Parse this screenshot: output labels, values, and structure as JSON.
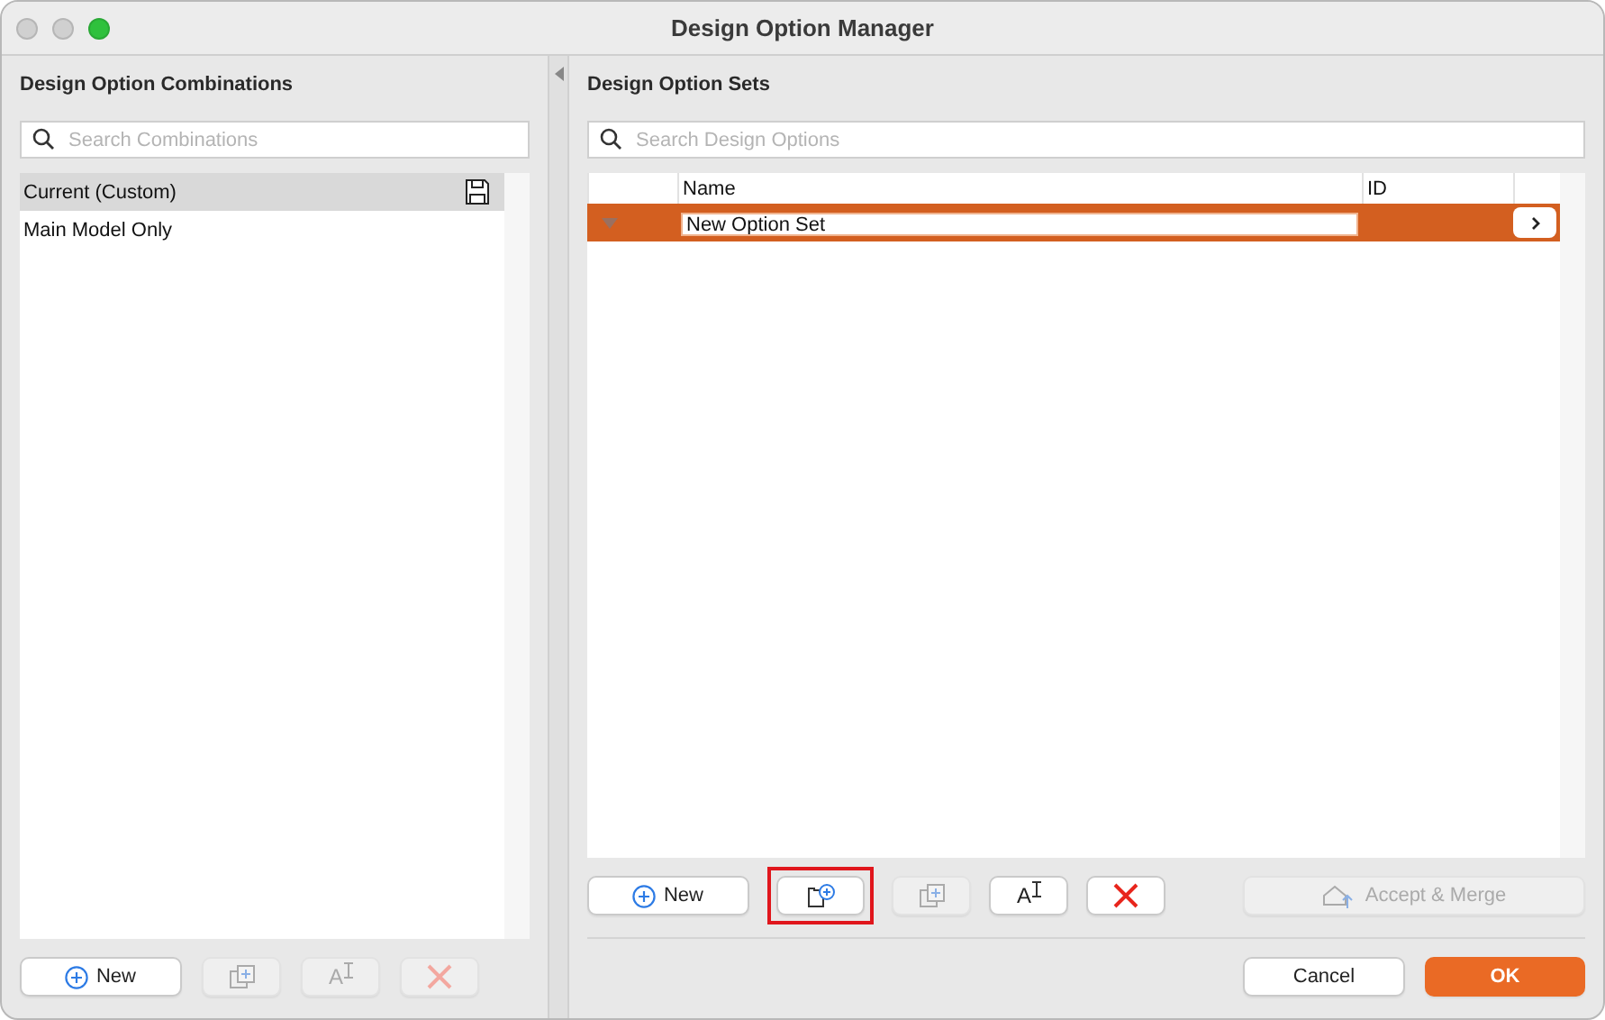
{
  "window": {
    "title": "Design Option Manager"
  },
  "combinations": {
    "title": "Design Option Combinations",
    "search": {
      "placeholder": "Search Combinations"
    },
    "items": [
      {
        "label": "Current (Custom)",
        "selected": true,
        "saved_icon": true
      },
      {
        "label": "Main Model Only",
        "selected": false,
        "saved_icon": false
      }
    ],
    "buttons": [
      {
        "kind": "new",
        "label": "New",
        "disabled": false
      },
      {
        "kind": "duplicate",
        "disabled": true
      },
      {
        "kind": "rename",
        "glyph": "A",
        "disabled": true
      },
      {
        "kind": "delete",
        "disabled": true
      }
    ]
  },
  "option_sets": {
    "title": "Design Option Sets",
    "search": {
      "placeholder": "Search Design Options"
    },
    "table": {
      "columns": [
        "Name",
        "ID"
      ],
      "rows": [
        {
          "name": "New Option Set",
          "id": "",
          "selected": true,
          "expanded": true,
          "editing": true
        }
      ]
    },
    "buttons": [
      {
        "kind": "new",
        "label": "New",
        "disabled": false
      },
      {
        "kind": "new-folder",
        "disabled": false,
        "highlighted": true
      },
      {
        "kind": "duplicate",
        "disabled": true
      },
      {
        "kind": "rename",
        "glyph": "A",
        "disabled": false
      },
      {
        "kind": "delete",
        "disabled": false
      },
      {
        "kind": "merge",
        "label": "Accept & Merge",
        "disabled": true
      }
    ]
  },
  "footer": {
    "cancel": "Cancel",
    "ok": "OK"
  }
}
